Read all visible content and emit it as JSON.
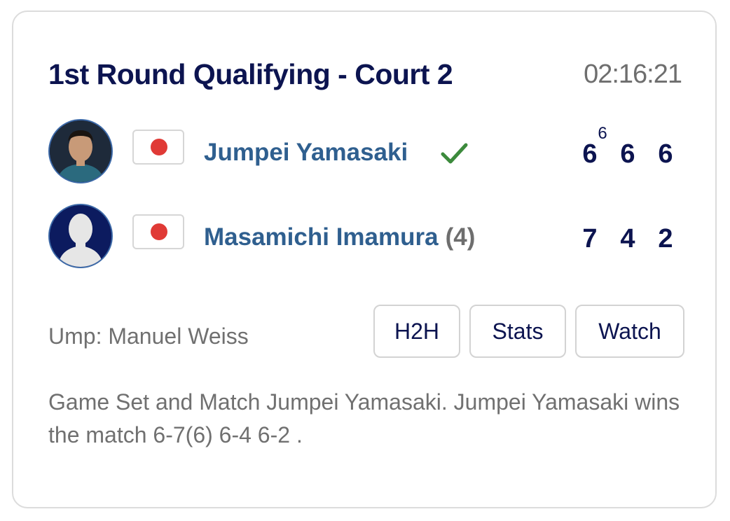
{
  "match": {
    "title": "1st Round Qualifying - Court 2",
    "duration": "02:16:21"
  },
  "players": [
    {
      "name": "Jumpei Yamasaki",
      "seed": "",
      "flag": "japan-flag",
      "winner": true,
      "scores": [
        "6",
        "6",
        "6"
      ],
      "tiebreaks": [
        "6",
        "",
        ""
      ]
    },
    {
      "name": "Masamichi Imamura",
      "seed": "(4)",
      "flag": "japan-flag",
      "winner": false,
      "scores": [
        "7",
        "4",
        "2"
      ],
      "tiebreaks": [
        "",
        "",
        ""
      ]
    }
  ],
  "umpire": "Ump: Manuel Weiss",
  "buttons": {
    "h2h": "H2H",
    "stats": "Stats",
    "watch": "Watch"
  },
  "summary": "Game Set and Match Jumpei Yamasaki. Jumpei Yamasaki wins the match 6-7(6) 6-4 6-2 .",
  "colors": {
    "title": "#0c1450",
    "player_name": "#2f5f8f",
    "check": "#3c8a3c",
    "flag_red": "#e03a36",
    "muted": "#707070"
  }
}
